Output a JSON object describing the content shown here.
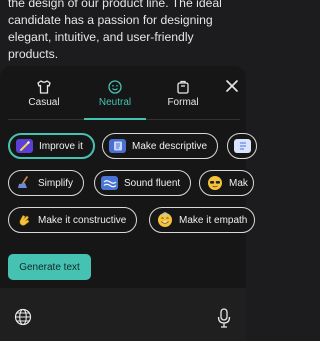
{
  "description": {
    "lines": [
      "the design of our product line. The ideal",
      "candidate has a passion for designing",
      "elegant, intuitive, and user-friendly products."
    ]
  },
  "tones": [
    {
      "label": "Casual",
      "icon": "tshirt-icon"
    },
    {
      "label": "Neutral",
      "icon": "smiley-icon",
      "active": true
    },
    {
      "label": "Formal",
      "icon": "briefcase-icon"
    }
  ],
  "chips": [
    {
      "label": "Improve it",
      "icon": "magic-wand-icon",
      "selected": true
    },
    {
      "label": "Make descriptive",
      "icon": "notebook-icon"
    },
    {
      "label": "Simplify",
      "icon": "broom-icon"
    },
    {
      "label": "Sound fluent",
      "icon": "waves-icon"
    },
    {
      "label": "Mak",
      "icon": "sunglasses-icon"
    },
    {
      "label": "Make it constructive",
      "icon": "waving-hand-icon"
    },
    {
      "label": "Make it empath",
      "icon": "smiling-face-icon"
    }
  ],
  "actions": {
    "generate_label": "Generate text"
  },
  "colors": {
    "accent": "#46c2b2",
    "panel": "#161616",
    "background": "#1c1c1e"
  }
}
